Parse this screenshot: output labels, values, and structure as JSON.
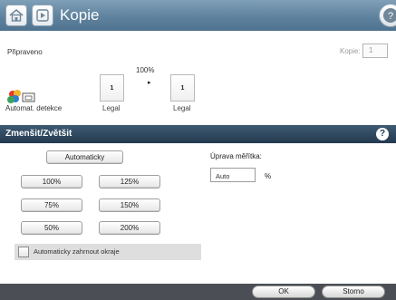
{
  "header": {
    "title": "Kopie",
    "home_icon": "home-icon",
    "app_icon": "copy-app-icon",
    "help_icon": "help-icon"
  },
  "status": {
    "text": "Připraveno",
    "copies_label": "Kopie:",
    "copies_value": "1"
  },
  "preview": {
    "zoom": "100%",
    "arrow": "▸",
    "source_page": "1",
    "dest_page": "1",
    "source_size": "Legal",
    "dest_size": "Legal",
    "auto_detect": "Automat. detekce"
  },
  "section": {
    "title": "Zmenšit/Zvětšit",
    "help": "?"
  },
  "buttons": {
    "auto": "Automaticky",
    "b100": "100%",
    "b125": "125%",
    "b75": "75%",
    "b150": "150%",
    "b50": "50%",
    "b200": "200%"
  },
  "checkbox": {
    "label": "Automaticky zahrnout okraje",
    "checked": false
  },
  "scale": {
    "label": "Úprava měřítka:",
    "value": "Auto",
    "unit": "%"
  },
  "footer": {
    "ok": "OK",
    "cancel": "Storno"
  },
  "colors": {
    "titlebar": "#5f829e",
    "section_header": "#2f4860",
    "footer": "#4b4f55"
  }
}
